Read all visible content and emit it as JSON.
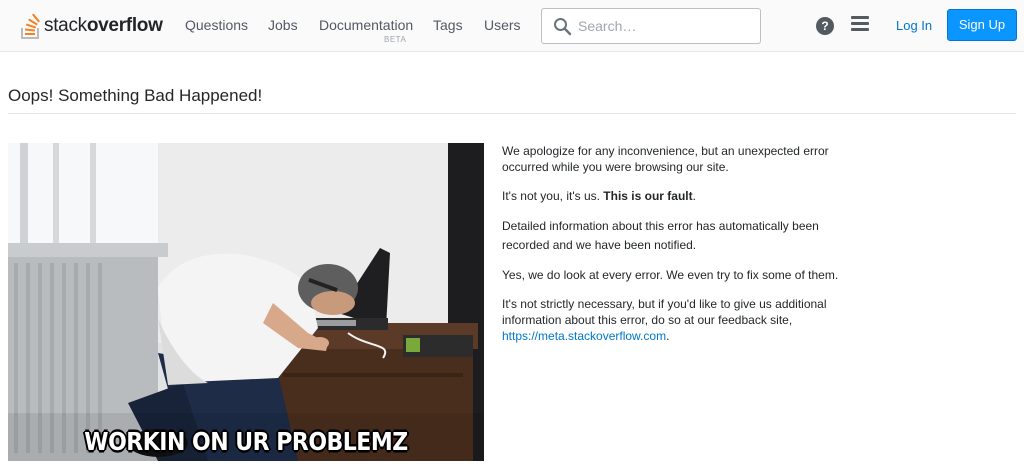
{
  "header": {
    "logo_prefix": "stack",
    "logo_suffix": "overflow",
    "nav": [
      {
        "label": "Questions"
      },
      {
        "label": "Jobs"
      },
      {
        "label": "Documentation",
        "badge": "BETA"
      },
      {
        "label": "Tags"
      },
      {
        "label": "Users"
      }
    ],
    "search_placeholder": "Search…",
    "help_glyph": "?",
    "login_label": "Log In",
    "signup_label": "Sign Up"
  },
  "main": {
    "title": "Oops! Something Bad Happened!",
    "image_caption": "WORKIN ON UR PROBLEMZ",
    "paragraphs": {
      "p1": "We apologize for any inconvenience, but an unexpected error occurred while you were browsing our site.",
      "p2_prefix": "It's not you, it's us. ",
      "p2_bold": "This is our fault",
      "p2_suffix": ".",
      "p3": "Detailed information about this error has automatically been recorded and we have been notified.",
      "p4": "Yes, we do look at every error. We even try to fix some of them.",
      "p5_prefix": "It's not strictly necessary, but if you'd like to give us additional information about this error, do so at our feedback site, ",
      "p5_link": "https://meta.stackoverflow.com",
      "p5_suffix": "."
    }
  },
  "colors": {
    "brand_orange": "#f48024",
    "link_blue": "#0077cc",
    "signup_blue": "#0a95ff"
  }
}
